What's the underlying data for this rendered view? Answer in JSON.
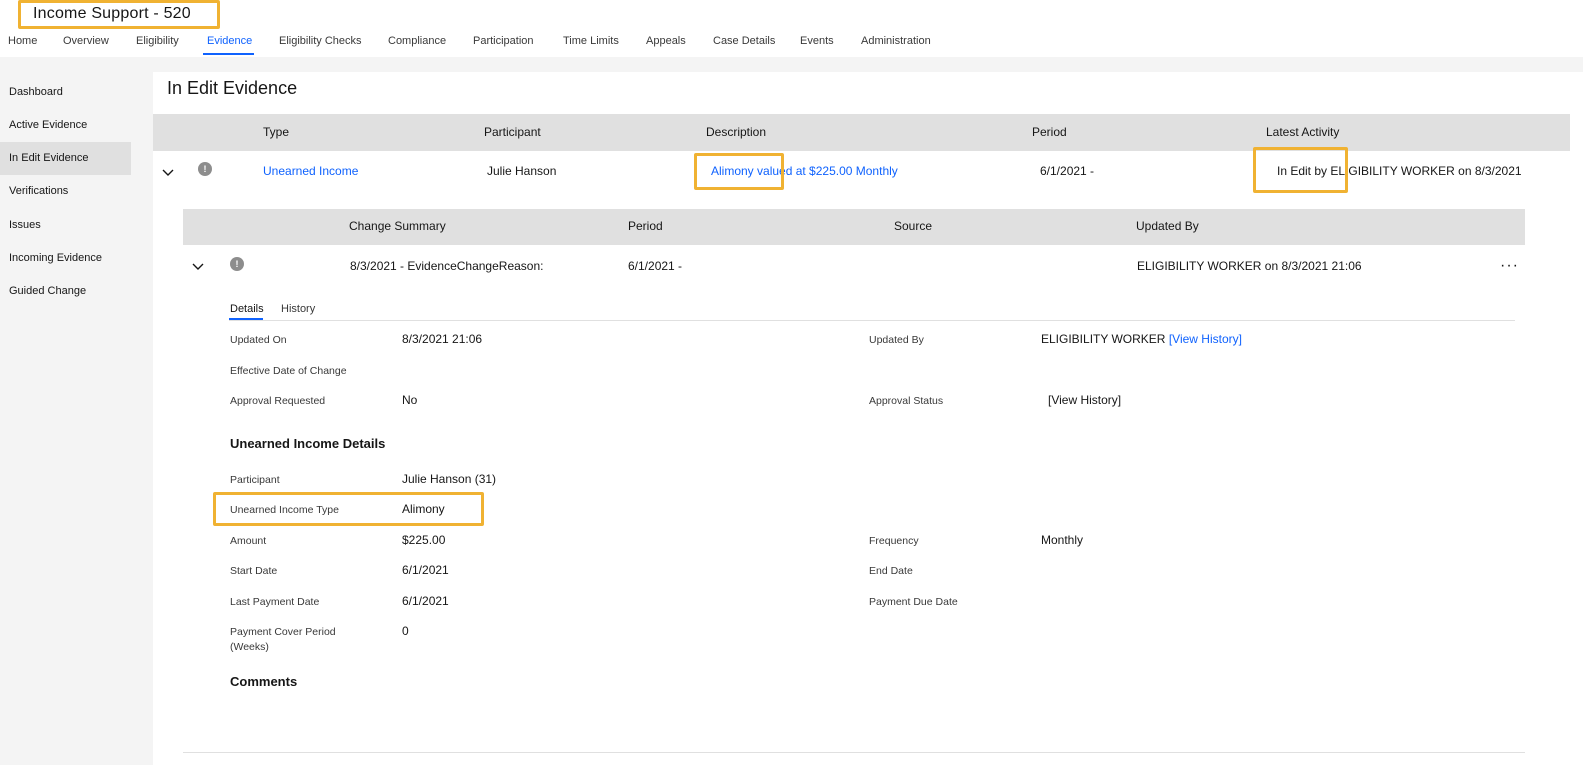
{
  "header": {
    "title": "Income Support - 520",
    "tabs": [
      {
        "label": "Home"
      },
      {
        "label": "Overview"
      },
      {
        "label": "Eligibility"
      },
      {
        "label": "Evidence"
      },
      {
        "label": "Eligibility Checks"
      },
      {
        "label": "Compliance"
      },
      {
        "label": "Participation"
      },
      {
        "label": "Time Limits"
      },
      {
        "label": "Appeals"
      },
      {
        "label": "Case Details"
      },
      {
        "label": "Events"
      },
      {
        "label": "Administration"
      }
    ],
    "active_tab": "Evidence"
  },
  "sidebar": {
    "items": [
      {
        "label": "Dashboard"
      },
      {
        "label": "Active Evidence"
      },
      {
        "label": "In Edit Evidence"
      },
      {
        "label": "Verifications"
      },
      {
        "label": "Issues"
      },
      {
        "label": "Incoming Evidence"
      },
      {
        "label": "Guided Change"
      }
    ],
    "active_item": "In Edit Evidence"
  },
  "main": {
    "title": "In Edit Evidence",
    "columns": [
      "Type",
      "Participant",
      "Description",
      "Period",
      "Latest Activity"
    ],
    "row": {
      "type": "Unearned Income",
      "participant": "Julie Hanson",
      "description": "Alimony valued at $225.00 Monthly",
      "period": "6/1/2021 -",
      "latest_activity": "In Edit by ELIGIBILITY WORKER on 8/3/2021"
    },
    "change_table": {
      "columns": [
        "Change Summary",
        "Period",
        "Source",
        "Updated By"
      ],
      "row": {
        "summary": "8/3/2021 - EvidenceChangeReason:",
        "period": "6/1/2021 -",
        "source": "",
        "updated_by": "ELIGIBILITY WORKER on 8/3/2021 21:06"
      },
      "overflow_label": "···"
    },
    "detail_tabs": [
      {
        "label": "Details"
      },
      {
        "label": "History"
      }
    ],
    "details": {
      "updated_on_label": "Updated On",
      "updated_on": "8/3/2021 21:06",
      "updated_by_label": "Updated By",
      "updated_by": "ELIGIBILITY WORKER",
      "updated_by_link": "[View History]",
      "effective_date_label": "Effective Date of Change",
      "approval_requested_label": "Approval Requested",
      "approval_requested": "No",
      "approval_status_label": "Approval Status",
      "approval_status_link": "[View History]"
    },
    "unearned_section": {
      "title": "Unearned Income Details",
      "participant_label": "Participant",
      "participant": "Julie Hanson (31)",
      "type_label": "Unearned Income Type",
      "type": "Alimony",
      "amount_label": "Amount",
      "amount": "$225.00",
      "frequency_label": "Frequency",
      "frequency": "Monthly",
      "start_date_label": "Start Date",
      "start_date": "6/1/2021",
      "end_date_label": "End Date",
      "last_payment_label": "Last Payment Date",
      "last_payment": "6/1/2021",
      "payment_due_label": "Payment Due Date",
      "cover_period_label_1": "Payment Cover Period",
      "cover_period_label_2": "(Weeks)",
      "cover_period": "0"
    },
    "comments_title": "Comments"
  },
  "colors": {
    "link": "#0f62fe",
    "highlight": "#f0b232",
    "header_bg": "#e0e0e0"
  }
}
